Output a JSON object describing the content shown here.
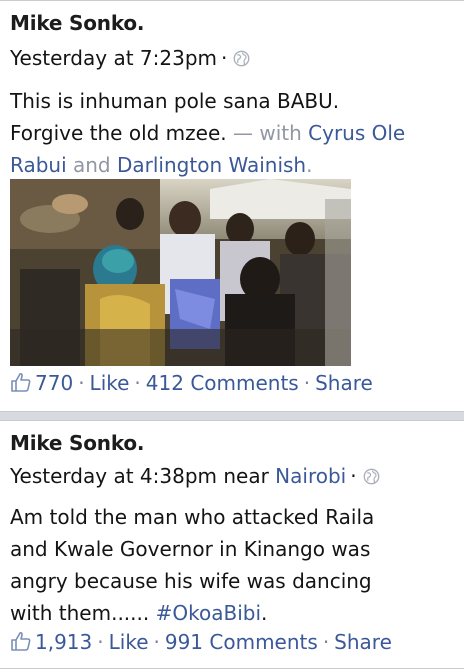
{
  "posts": [
    {
      "author": "Mike Sonko.",
      "time": "Yesterday at 7:23pm",
      "location": "",
      "privacy_icon": "globe-icon",
      "text_line1": "This is inhuman pole sana BABU.",
      "text_line2_start": "Forgive the old mzee.",
      "with_prefix": "— with",
      "tag1": "Cyrus Ole",
      "tag1_cont": "Rabui",
      "and_word": "and",
      "tag2": "Darlington Wainish",
      "tag_end": ".",
      "likes": "770",
      "like_label": "Like",
      "comments": "412 Comments",
      "share_label": "Share"
    },
    {
      "author": "Mike Sonko.",
      "time": "Yesterday at 4:38pm near",
      "location": "Nairobi",
      "privacy_icon": "globe-icon",
      "text_line1": "Am told the man who attacked Raila",
      "text_line2": "and Kwale Governor in Kinango was",
      "text_line3": "angry because his wife was dancing",
      "text_line4_start": "with them......",
      "hashtag": "#OkoaBibi",
      "hashtag_end": ".",
      "likes": "1,913",
      "like_label": "Like",
      "comments": "991 Comments",
      "share_label": "Share"
    }
  ],
  "colors": {
    "link": "#3b5998",
    "muted": "#9197a3",
    "text": "#141414"
  }
}
